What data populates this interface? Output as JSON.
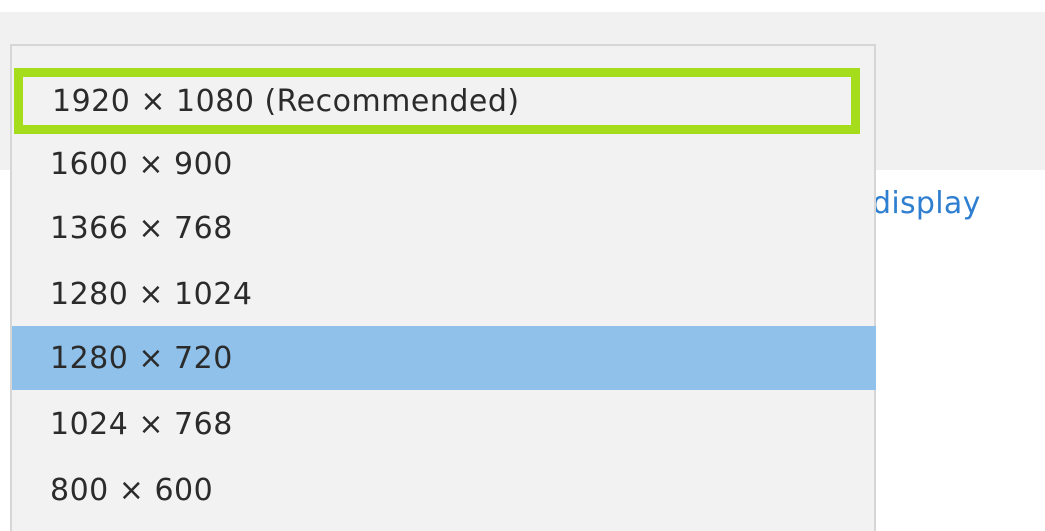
{
  "background_link": {
    "label": "display"
  },
  "resolution_menu": {
    "options": [
      {
        "label": "1920 × 1080 (Recommended)",
        "state": "highlighted"
      },
      {
        "label": "1600 × 900",
        "state": "normal"
      },
      {
        "label": "1366 × 768",
        "state": "normal"
      },
      {
        "label": "1280 × 1024",
        "state": "normal"
      },
      {
        "label": "1280 × 720",
        "state": "selected"
      },
      {
        "label": "1024 × 768",
        "state": "normal"
      },
      {
        "label": "800 × 600",
        "state": "normal"
      }
    ]
  },
  "colors": {
    "highlight_outline": "#a5dc1b",
    "selected_background": "#8fc1ea",
    "link": "#2f7fd0",
    "menu_background": "#f2f2f2"
  }
}
